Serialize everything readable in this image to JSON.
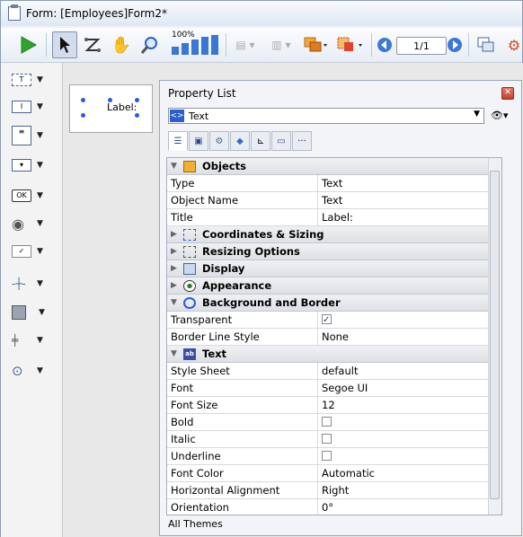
{
  "window": {
    "title": "Form: [Employees]Form2*"
  },
  "toolbar": {
    "zoom_percent": "100%",
    "page_indicator": "1/1"
  },
  "form": {
    "label_text": "Label:"
  },
  "property_list": {
    "title": "Property List",
    "object_type": "Text",
    "footer": "All Themes",
    "sections": {
      "objects": "Objects",
      "coordinates": "Coordinates & Sizing",
      "resizing": "Resizing Options",
      "display": "Display",
      "appearance": "Appearance",
      "background": "Background and Border",
      "text": "Text"
    },
    "rows": {
      "type": {
        "k": "Type",
        "v": "Text"
      },
      "object_name": {
        "k": "Object Name",
        "v": "Text"
      },
      "title": {
        "k": "Title",
        "v": "Label:"
      },
      "transparent": {
        "k": "Transparent",
        "checked": true
      },
      "border_line_style": {
        "k": "Border Line Style",
        "v": "None"
      },
      "style_sheet": {
        "k": "Style Sheet",
        "v": "default"
      },
      "font": {
        "k": "Font",
        "v": "Segoe UI"
      },
      "font_size": {
        "k": "Font Size",
        "v": "12"
      },
      "bold": {
        "k": "Bold",
        "checked": false
      },
      "italic": {
        "k": "Italic",
        "checked": false
      },
      "underline": {
        "k": "Underline",
        "checked": false
      },
      "font_color": {
        "k": "Font Color",
        "v": "Automatic"
      },
      "horizontal_alignment": {
        "k": "Horizontal Alignment",
        "v": "Right"
      },
      "orientation": {
        "k": "Orientation",
        "v": "0°"
      }
    }
  },
  "colors": {
    "accent": "#2a5ed1",
    "run_green": "#2fa52f",
    "section_bg": "#dde0e5"
  }
}
